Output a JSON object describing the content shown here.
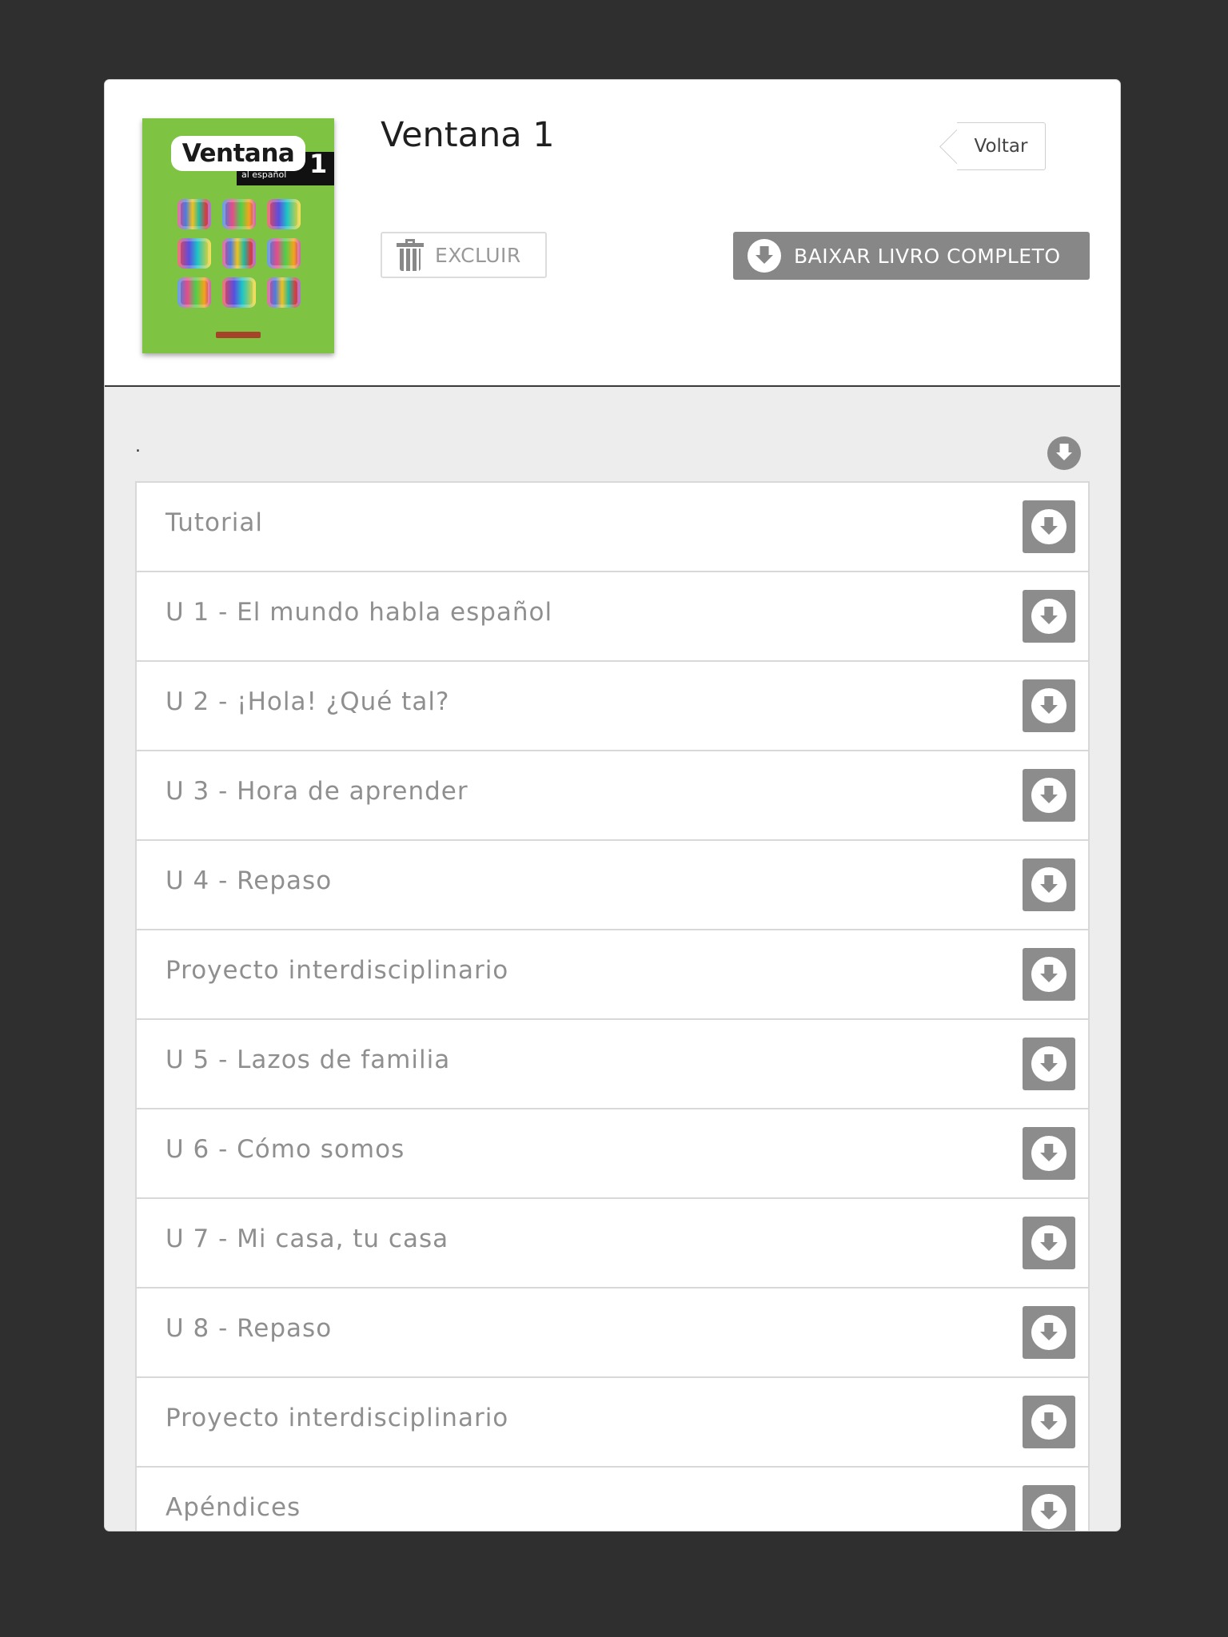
{
  "book": {
    "title": "Ventana 1",
    "cover": {
      "title": "Ventana",
      "subtitle": "al español",
      "number": "1",
      "background_color": "#7fc342"
    }
  },
  "header": {
    "back_label": "Voltar",
    "delete_label": "EXCLUIR",
    "download_all_label": "BAIXAR LIVRO COMPLETO"
  },
  "section": {
    "title": "."
  },
  "chapters": [
    {
      "label": "Tutorial"
    },
    {
      "label": "U 1 - El mundo habla español"
    },
    {
      "label": "U 2 - ¡Hola! ¿Qué tal?"
    },
    {
      "label": "U 3 - Hora de aprender"
    },
    {
      "label": "U 4 - Repaso"
    },
    {
      "label": "Proyecto interdisciplinario"
    },
    {
      "label": "U 5 - Lazos de familia"
    },
    {
      "label": "U 6 - Cómo somos"
    },
    {
      "label": "U 7 - Mi casa, tu casa"
    },
    {
      "label": "U 8 - Repaso"
    },
    {
      "label": "Proyecto interdisciplinario"
    },
    {
      "label": "Apéndices"
    }
  ],
  "icons": {
    "delete": "trash-icon",
    "download": "download-icon"
  },
  "colors": {
    "backdrop": "#2f2f2f",
    "download_button": "#878787",
    "label_gray": "#8f8f8f"
  }
}
